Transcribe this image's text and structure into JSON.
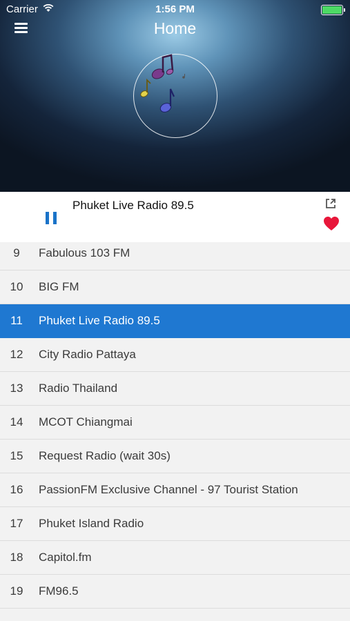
{
  "status_bar": {
    "carrier": "Carrier",
    "time": "1:56 PM"
  },
  "header": {
    "title": "Home"
  },
  "player": {
    "now_playing": "Phuket Live Radio 89.5"
  },
  "colors": {
    "accent": "#1f78d1",
    "heart": "#e8163a",
    "battery": "#4cd964"
  },
  "stations": [
    {
      "num": "9",
      "name": "Fabulous 103 FM",
      "active": false
    },
    {
      "num": "10",
      "name": "BIG FM",
      "active": false
    },
    {
      "num": "11",
      "name": "Phuket Live Radio 89.5",
      "active": true
    },
    {
      "num": "12",
      "name": "City Radio Pattaya",
      "active": false
    },
    {
      "num": "13",
      "name": "Radio Thailand",
      "active": false
    },
    {
      "num": "14",
      "name": "MCOT Chiangmai",
      "active": false
    },
    {
      "num": "15",
      "name": "Request Radio (wait 30s)",
      "active": false
    },
    {
      "num": "16",
      "name": "PassionFM Exclusive Channel - 97 Tourist Station",
      "active": false
    },
    {
      "num": "17",
      "name": "Phuket Island Radio",
      "active": false
    },
    {
      "num": "18",
      "name": "Capitol.fm",
      "active": false
    },
    {
      "num": "19",
      "name": "FM96.5",
      "active": false
    }
  ]
}
